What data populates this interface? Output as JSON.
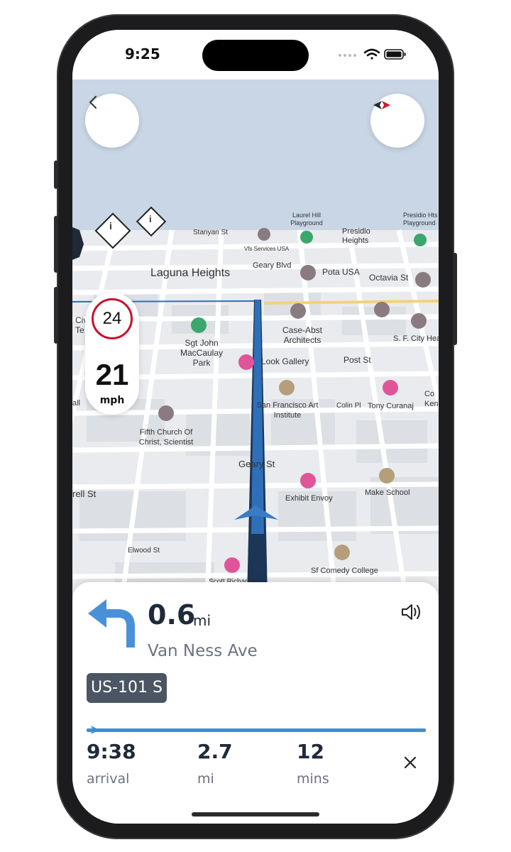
{
  "status_bar": {
    "time": "9:25"
  },
  "map": {
    "labels": {
      "laguna_heights": "Laguna Heights",
      "stanyan_st": "Stanyan St",
      "vfs_services": "Vfs Services USA",
      "geary_blvd": "Geary Blvd",
      "pota_usa": "Pota USA",
      "laurel_hill": "Laurel Hill Playground",
      "presidio_heights": "Presidio Heights",
      "presidio_hts_playground": "Presidio Hts Playground",
      "octavia_st": "Octavia St",
      "sgt_john": "Sgt John MacCaulay Park",
      "case_abst": "Case-Abst Architects",
      "look_gallery": "Look Gallery",
      "post_st": "Post St",
      "sf_city_health": "S. F. City Health Department",
      "sf_art_institute": "San Francisco Art Institute",
      "colin_pl": "Colin Pl",
      "tony_curanaj": "Tony Curanaj",
      "fifth_church": "Fifth Church Of Christ, Scientist",
      "geary_st": "Geary St",
      "exhibit_envoy": "Exhibit Envoy",
      "make_school": "Make School",
      "elwood_st": "Elwood St",
      "sf_comedy": "Sf Comedy College",
      "scott_richards": "Scott Richards",
      "civic_edge": "Civ Te",
      "rell_st": "rell St",
      "all_edge": "all",
      "ken_edge": "Co Ken"
    },
    "info_marker_glyph": "i"
  },
  "speed": {
    "limit": "24",
    "current": "21",
    "unit": "mph"
  },
  "instruction": {
    "distance": "0.6",
    "distance_unit": "mi",
    "street": "Van Ness Ave",
    "road_shield": "US-101 S"
  },
  "trip": {
    "arrival_value": "9:38",
    "arrival_label": "arrival",
    "distance_value": "2.7",
    "distance_label": "mi",
    "time_value": "12",
    "time_label": "mins"
  },
  "icons": {
    "back": "chevron-left-icon",
    "compass": "compass-icon",
    "turn": "turn-left-icon",
    "sound": "speaker-icon",
    "close": "close-icon"
  },
  "colors": {
    "route": "#2e6fb8",
    "limit_ring": "#c8102e",
    "progress": "#3b8fd1",
    "shield": "#4b5563"
  }
}
